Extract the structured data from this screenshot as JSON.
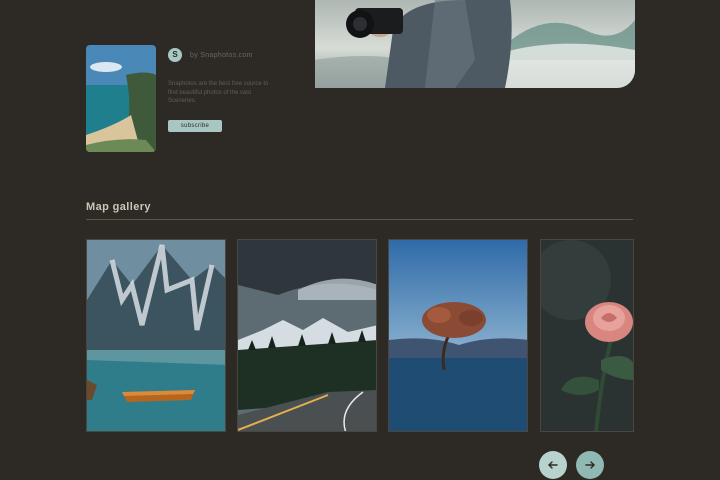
{
  "profile": {
    "avatar_initial": "S",
    "author_name": "by Snaphotos.com",
    "blurb": "Snaphotos are the best free source to find beautiful photos of the vast Sceneries.",
    "subscribe_label": "subscribe"
  },
  "gallery": {
    "title": "Map gallery",
    "cards": [
      {
        "label": "mountain-lake"
      },
      {
        "label": "mountain-road"
      },
      {
        "label": "lone-tree"
      },
      {
        "label": "pink-rose"
      }
    ]
  },
  "nav": {
    "prev_icon": "arrow-left-icon",
    "next_icon": "arrow-right-icon"
  },
  "colors": {
    "background": "#2d2a26",
    "accent": "#a9c7c2",
    "accent_dark": "#8fb9b2",
    "divider": "#5a5a40"
  }
}
